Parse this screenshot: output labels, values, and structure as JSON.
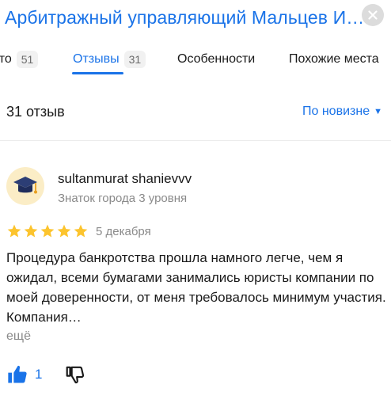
{
  "header": {
    "title": "Арбитражный управляющий Мальцев Игорь Анатольевич"
  },
  "tabs": [
    {
      "label": "Фото",
      "count": "51"
    },
    {
      "label": "Отзывы",
      "count": "31"
    },
    {
      "label": "Особенности"
    },
    {
      "label": "Похожие места"
    }
  ],
  "reviews_summary": {
    "count_label": "31 отзыв",
    "sort_label": "По новизне"
  },
  "review": {
    "author": "sultanmurat shanievvv",
    "level": "Знаток города 3 уровня",
    "rating": 5,
    "date": "5 декабря",
    "text": "Процедура банкротства прошла намного легче, чем я ожидал, всеми бумагами занимались юристы компании по моей доверенности, от меня требовалось минимум участия. Компания…",
    "more_label": "ещё",
    "likes": "1"
  },
  "colors": {
    "accent": "#1a73e8",
    "star": "#fcc42e"
  }
}
